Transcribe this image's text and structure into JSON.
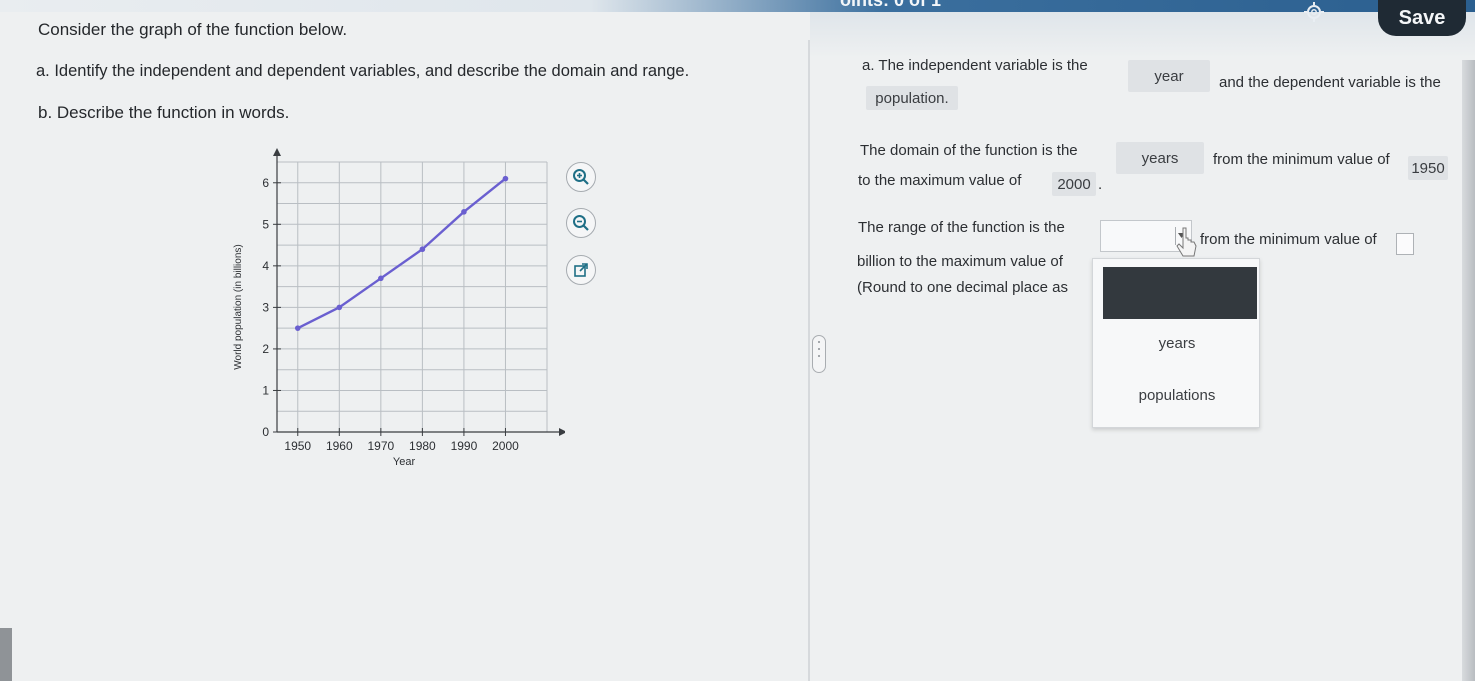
{
  "header": {
    "points_text": "oints: 0 of 1",
    "save_label": "Save"
  },
  "question": {
    "intro": "Consider the graph of the function below.",
    "part_a": "a. Identify the independent and dependent variables, and describe the domain and range.",
    "part_b": "b. Describe the function in words."
  },
  "chart_data": {
    "type": "line",
    "x": [
      1950,
      1960,
      1970,
      1980,
      1990,
      2000
    ],
    "values": [
      2.5,
      3.0,
      3.7,
      4.4,
      5.3,
      6.1
    ],
    "xlabel": "Year",
    "ylabel": "World population (in billions)",
    "xticks": [
      "1950",
      "1960",
      "1970",
      "1980",
      "1990",
      "2000"
    ],
    "yticks": [
      "0",
      "1",
      "2",
      "3",
      "4",
      "5",
      "6"
    ],
    "xlim": [
      1945,
      2010
    ],
    "ylim": [
      0,
      6.5
    ],
    "grid": true,
    "line_color": "#6a5fd0"
  },
  "tools": {
    "zoom_in": "zoom-in",
    "zoom_out": "zoom-out",
    "popout": "popout"
  },
  "answer": {
    "line1_prefix": "a. The independent variable is the",
    "independent_value": "year",
    "line1_mid": "and the dependent variable is the",
    "dependent_value": "population.",
    "domain_prefix": "The domain of the function is the",
    "domain_value": "years",
    "domain_mid": "from the minimum value of",
    "domain_min": "1950",
    "domain_line2": "to the maximum value of",
    "domain_max": "2000",
    "domain_end": ".",
    "range_prefix": "The range of the function is the",
    "range_mid": "from the minimum value of",
    "range_line2": "billion to the maximum value of",
    "round_note": "(Round to one decimal place as"
  },
  "dropdown": {
    "options": [
      "years",
      "populations"
    ]
  }
}
